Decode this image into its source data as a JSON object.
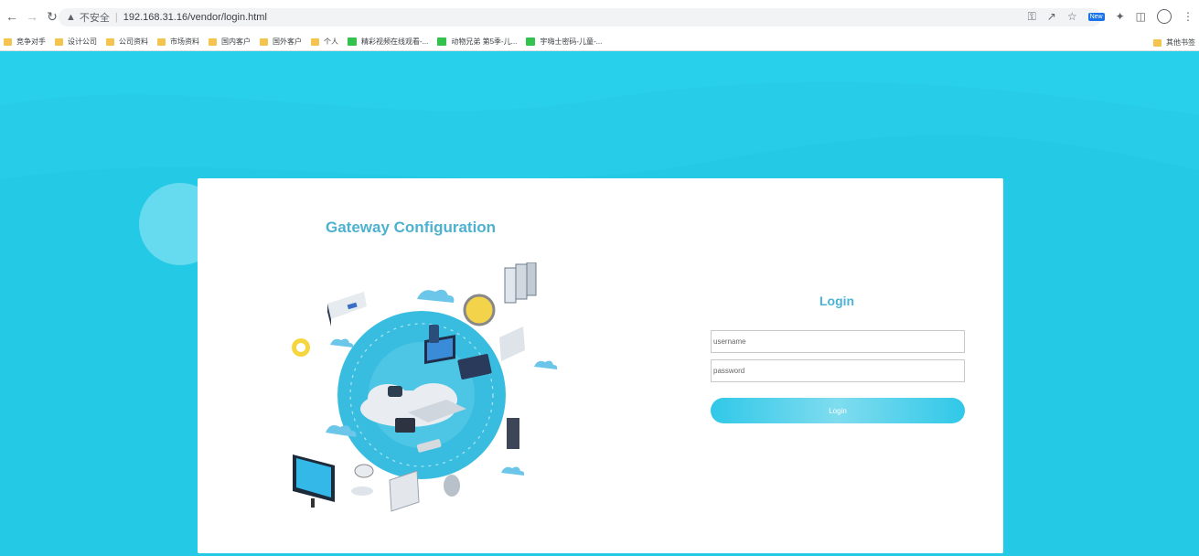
{
  "browser": {
    "address": {
      "security_label": "不安全",
      "url": "192.168.31.16/vendor/login.html"
    },
    "extension_badge": "New",
    "bookmarks": [
      {
        "label": "竞争对手",
        "icon": "folder-icon"
      },
      {
        "label": "设计公司",
        "icon": "folder-icon"
      },
      {
        "label": "公司资料",
        "icon": "folder-icon"
      },
      {
        "label": "市场资料",
        "icon": "folder-icon"
      },
      {
        "label": "国内客户",
        "icon": "folder-icon"
      },
      {
        "label": "国外客户",
        "icon": "folder-icon"
      },
      {
        "label": "个人",
        "icon": "folder-icon"
      },
      {
        "label": "精彩视频在线观看-...",
        "icon": "tv-icon"
      },
      {
        "label": "动物兄弟 第5季-儿...",
        "icon": "tv-icon"
      },
      {
        "label": "宇嗨士密码-儿童-...",
        "icon": "tv-icon"
      }
    ],
    "other_bookmarks": "其他书签"
  },
  "card": {
    "title": "Gateway Configuration"
  },
  "login": {
    "title": "Login",
    "username_placeholder": "username",
    "password_placeholder": "password",
    "button_label": "Login"
  },
  "colors": {
    "page_background": "#27cde8",
    "title_color": "#4db1cf",
    "button_accent": "#30c8e8"
  }
}
